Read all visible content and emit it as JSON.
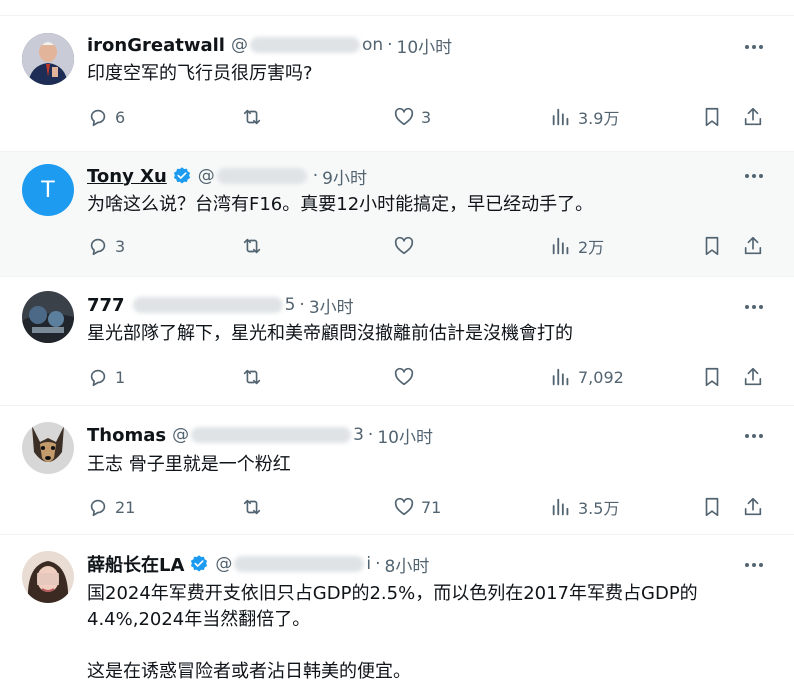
{
  "tweets": [
    {
      "name": "ironGreatwall",
      "handle": "@",
      "handle_tail": "on",
      "time": "10小时",
      "text": "印度空军的飞行员很厉害吗?",
      "replies": "6",
      "retweets": "",
      "likes": "3",
      "views": "3.9万"
    },
    {
      "name": "Tony Xu",
      "handle": "@",
      "handle_tail": "",
      "time": "9小时",
      "text": "为啥这么说？台湾有F16。真要12小时能搞定，早已经动手了。",
      "replies": "3",
      "retweets": "",
      "likes": "",
      "views": "2万",
      "avatar_letter": "T"
    },
    {
      "name": "777",
      "handle": "",
      "handle_tail": "5",
      "time": "3小时",
      "text": "星光部隊了解下，星光和美帝顧問沒撤離前估計是沒機會打的",
      "replies": "1",
      "retweets": "",
      "likes": "",
      "views": "7,092"
    },
    {
      "name": "Thomas",
      "handle": "@",
      "handle_tail": "3",
      "time": "10小时",
      "text": "王志  骨子里就是一个粉红",
      "replies": "21",
      "retweets": "",
      "likes": "71",
      "views": "3.5万"
    },
    {
      "name": "薛船长在LA",
      "handle": "@",
      "handle_tail": "i",
      "time": "8小时",
      "text": "  国2024年军费开支依旧只占GDP的2.5%，而以色列在2017年军费占GDP的\n4.4%,2024年当然翻倍了。\n\n这是在诱惑冒险者或者沾日韩美的便宜。"
    }
  ],
  "colors": {
    "text": "#0f1419",
    "secondary": "#536471",
    "verified": "#1d9bf0",
    "border": "#eff3f4",
    "highlight_bg": "#f7f9f9"
  },
  "icons": [
    "more-icon",
    "reply-icon",
    "retweet-icon",
    "like-icon",
    "views-icon",
    "bookmark-icon",
    "share-icon",
    "verified-icon"
  ]
}
